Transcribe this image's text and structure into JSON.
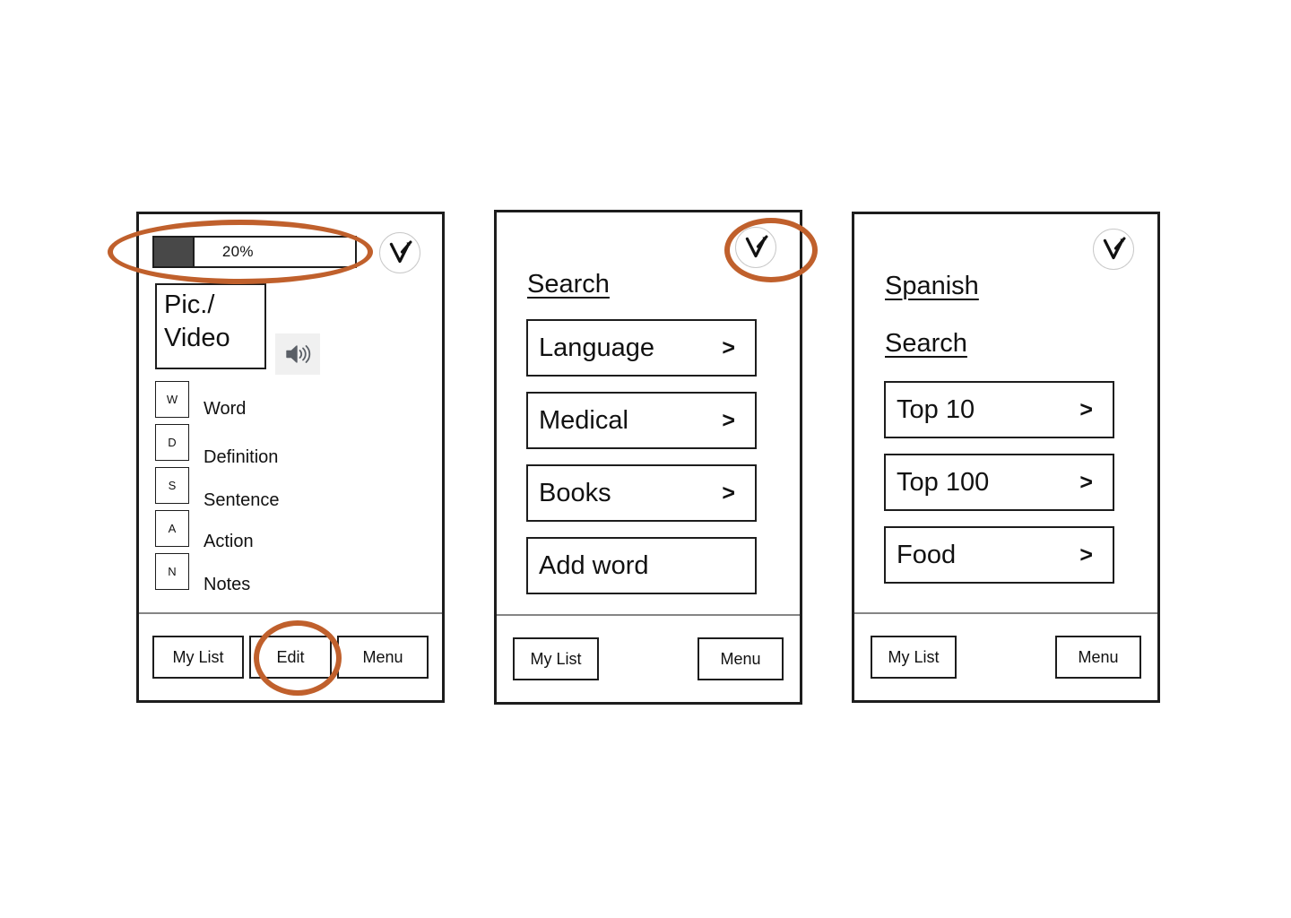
{
  "meta": {
    "accent_orange": "#c0602c",
    "frame_stroke": "#1d1d1d",
    "progress_fill_color": "#484848"
  },
  "screen1": {
    "name": "word-detail",
    "progress": {
      "label": "20%",
      "percent": 20
    },
    "badge_icon": "v-arrow-icon",
    "media": {
      "label_line1": "Pic./",
      "label_line2": "Video"
    },
    "speaker_icon": "speaker-icon",
    "attributes": [
      {
        "key": "W",
        "label": "Word"
      },
      {
        "key": "D",
        "label": "Definition"
      },
      {
        "key": "S",
        "label": "Sentence"
      },
      {
        "key": "A",
        "label": "Action"
      },
      {
        "key": "N",
        "label": "Notes"
      }
    ],
    "bottom_bar": [
      {
        "label": "My List"
      },
      {
        "label": "Edit"
      },
      {
        "label": "Menu"
      }
    ]
  },
  "screen2": {
    "name": "search-categories",
    "heading": "Search",
    "badge_icon": "v-arrow-icon",
    "items": [
      {
        "label": "Language",
        "chevron": ">"
      },
      {
        "label": "Medical",
        "chevron": ">"
      },
      {
        "label": "Books",
        "chevron": ">"
      },
      {
        "label": "Add word",
        "chevron": ""
      }
    ],
    "bottom_bar": [
      {
        "label": "My List"
      },
      {
        "label": "Menu"
      }
    ]
  },
  "screen3": {
    "name": "spanish-search",
    "heading_primary": "Spanish",
    "heading_secondary": "Search",
    "badge_icon": "v-arrow-icon",
    "items": [
      {
        "label": "Top 10",
        "chevron": ">"
      },
      {
        "label": "Top 100",
        "chevron": ">"
      },
      {
        "label": "Food",
        "chevron": ">"
      }
    ],
    "bottom_bar": [
      {
        "label": "My List"
      },
      {
        "label": "Menu"
      }
    ]
  },
  "annotations": [
    {
      "target": "progress-bar-row",
      "shape": "ellipse"
    },
    {
      "target": "edit-button",
      "shape": "ellipse"
    },
    {
      "target": "screen2-v-badge",
      "shape": "ellipse"
    }
  ]
}
